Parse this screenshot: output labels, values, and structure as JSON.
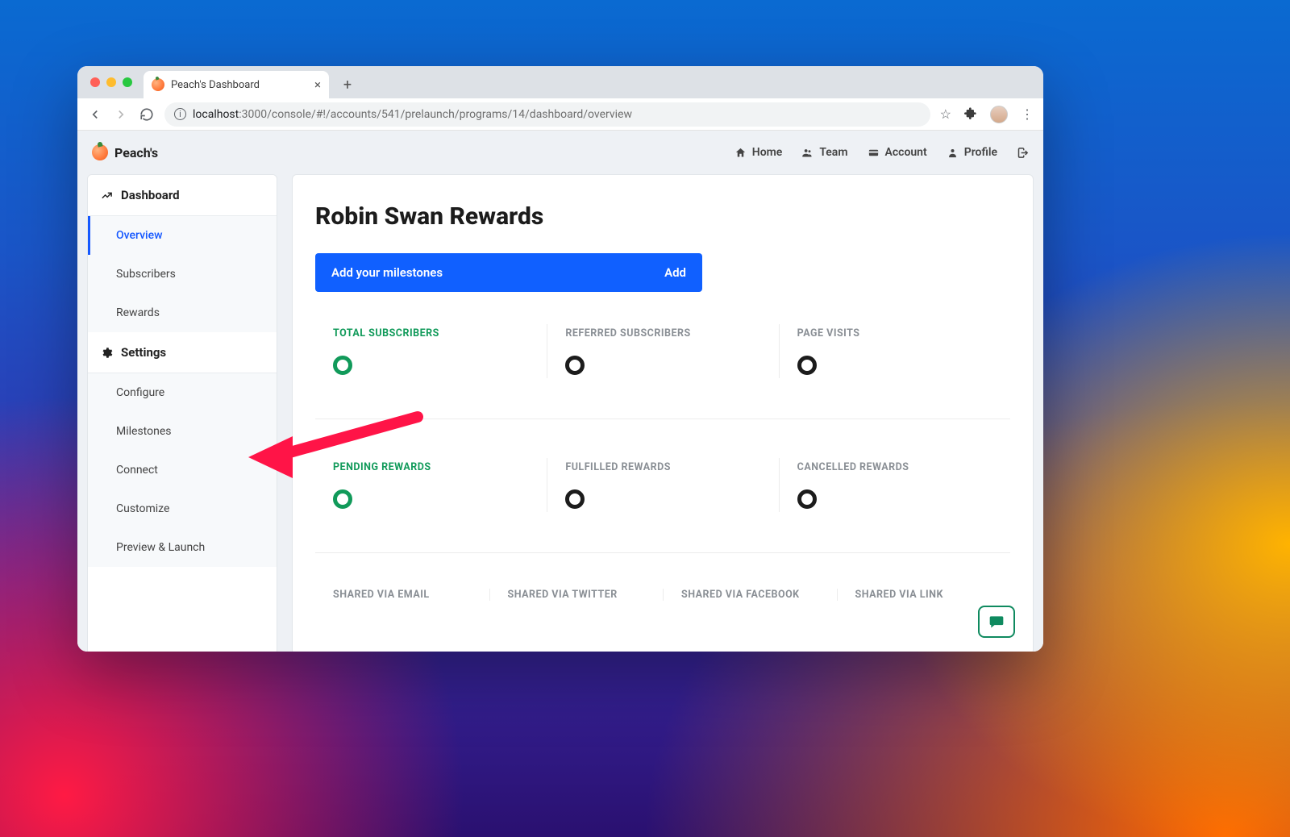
{
  "browser": {
    "tab_title": "Peach's Dashboard",
    "url_host": "localhost",
    "url_path": ":3000/console/#!/accounts/541/prelaunch/programs/14/dashboard/overview"
  },
  "app": {
    "brand": "Peach's",
    "topnav": {
      "home": "Home",
      "team": "Team",
      "account": "Account",
      "profile": "Profile"
    }
  },
  "sidebar": {
    "dashboard_hdr": "Dashboard",
    "dashboard_items": [
      "Overview",
      "Subscribers",
      "Rewards"
    ],
    "settings_hdr": "Settings",
    "settings_items": [
      "Configure",
      "Milestones",
      "Connect",
      "Customize",
      "Preview & Launch"
    ]
  },
  "page": {
    "title": "Robin Swan Rewards",
    "cta_text": "Add your milestones",
    "cta_action": "Add",
    "stats_row1": [
      {
        "label": "TOTAL SUBSCRIBERS",
        "value": "0",
        "highlight": true
      },
      {
        "label": "REFERRED SUBSCRIBERS",
        "value": "0",
        "highlight": false
      },
      {
        "label": "PAGE VISITS",
        "value": "0",
        "highlight": false
      }
    ],
    "stats_row2": [
      {
        "label": "PENDING REWARDS",
        "value": "0",
        "highlight": true
      },
      {
        "label": "FULFILLED REWARDS",
        "value": "0",
        "highlight": false
      },
      {
        "label": "CANCELLED REWARDS",
        "value": "0",
        "highlight": false
      }
    ],
    "shared_row": [
      "SHARED VIA EMAIL",
      "SHARED VIA TWITTER",
      "SHARED VIA FACEBOOK",
      "SHARED VIA LINK"
    ]
  }
}
